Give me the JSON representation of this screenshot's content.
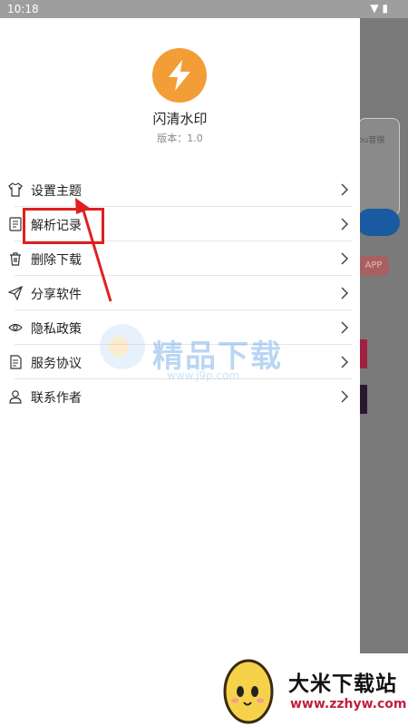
{
  "status_bar": {
    "time": "10:18",
    "icons": "▼ ▮"
  },
  "drawer": {
    "app_name": "闪清水印",
    "version": "版本：1.0",
    "menu": [
      {
        "label": "设置主题",
        "icon": "tshirt-icon"
      },
      {
        "label": "解析记录",
        "icon": "document-icon"
      },
      {
        "label": "删除下载",
        "icon": "trash-icon"
      },
      {
        "label": "分享软件",
        "icon": "send-icon"
      },
      {
        "label": "隐私政策",
        "icon": "eye-icon"
      },
      {
        "label": "服务协议",
        "icon": "agreement-icon"
      },
      {
        "label": "联系作者",
        "icon": "person-icon"
      }
    ]
  },
  "background_app": {
    "box_text": "ou音搜",
    "pink_button": "APP"
  },
  "watermark": {
    "title": "精品下载",
    "url": "www.j9p.com"
  },
  "footer_watermark": {
    "title": "大米下载站",
    "url": "www.zzhyw.com"
  },
  "colors": {
    "logo": "#f29d35",
    "highlight": "#e02020",
    "status_bar": "#9e9e9e"
  }
}
